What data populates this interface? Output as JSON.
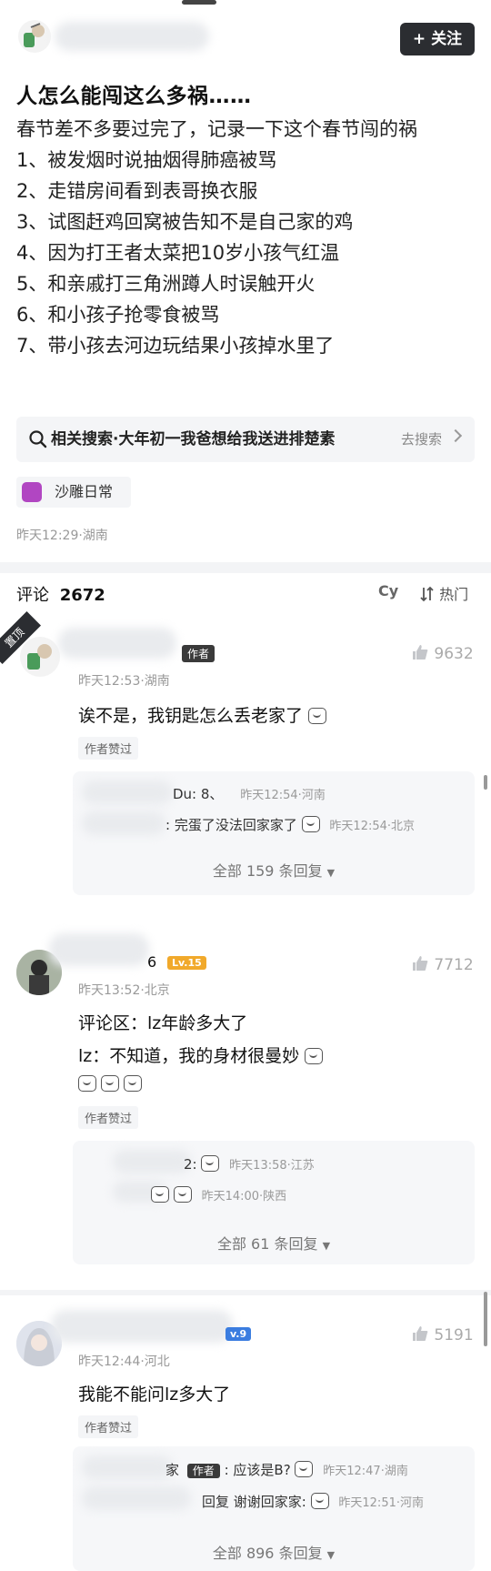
{
  "header": {
    "follow_label": "+ 关注"
  },
  "post": {
    "title": "人怎么能闯这么多祸……",
    "lines": [
      "春节差不多要过完了，记录一下这个春节闯的祸",
      "1、被发烟时说抽烟得肺癌被骂",
      "2、走错房间看到表哥换衣服",
      "3、试图赶鸡回窝被告知不是自己家的鸡",
      "4、因为打王者太菜把10岁小孩气红温",
      "5、和亲戚打三角洲蹲人时误触开火",
      "6、和小孩子抢零食被骂",
      "7、带小孩去河边玩结果小孩掉水里了"
    ],
    "related_search": "相关搜索·大年初一我爸想给我送进排楚素",
    "search_action": "去搜索",
    "tag": "沙雕日常",
    "meta": "昨天12:29·湖南"
  },
  "comments_header": {
    "label": "评论",
    "count": "2672",
    "sort_cy": "Cy",
    "sort_label": "热门"
  },
  "comments": [
    {
      "pinned": "置顶",
      "badge": "作者",
      "likes": "9632",
      "meta": "昨天12:53·湖南",
      "text": "诶不是，我钥匙怎么丢老家了",
      "liked_tag": "作者赞过",
      "replies": [
        {
          "name_suffix": "Du: 8、",
          "text": "",
          "meta": "昨天12:54·河南"
        },
        {
          "name_suffix": ":",
          "text": "完蛋了没法回家家了",
          "meta": "昨天12:54·北京"
        }
      ],
      "all_replies": "全部 159 条回复"
    },
    {
      "name_suffix": "6",
      "badge": "Lv.15",
      "likes": "7712",
      "meta": "昨天13:52·北京",
      "text_lines": [
        "评论区：lz年龄多大了",
        "lz：不知道，我的身材很曼妙"
      ],
      "liked_tag": "作者赞过",
      "replies": [
        {
          "name_suffix": "2:",
          "text": "",
          "meta": "昨天13:58·江苏"
        },
        {
          "name_suffix": "",
          "text": "",
          "meta": "昨天14:00·陕西"
        }
      ],
      "all_replies": "全部 61 条回复"
    },
    {
      "badge": "v.9",
      "likes": "5191",
      "meta": "昨天12:44·河北",
      "text": "我能不能问lz多大了",
      "liked_tag": "作者赞过",
      "replies": [
        {
          "name_suffix": "家",
          "badge": "作者",
          "text": ": 应该是B?",
          "meta": "昨天12:47·湖南"
        },
        {
          "name_suffix": "",
          "text": "回复 谢谢回家家:",
          "meta": "昨天12:51·河南"
        }
      ],
      "all_replies": "全部 896 条回复"
    }
  ],
  "colors": {
    "follow_bg": "#2b2d31",
    "lv_badge": "#f1a92b",
    "tag_icon": "#b146c2"
  },
  "icons": [
    "search-icon",
    "chevron-right-icon",
    "thumbs-up-icon",
    "sort-icon",
    "chevron-down-icon",
    "emoji-icon"
  ]
}
